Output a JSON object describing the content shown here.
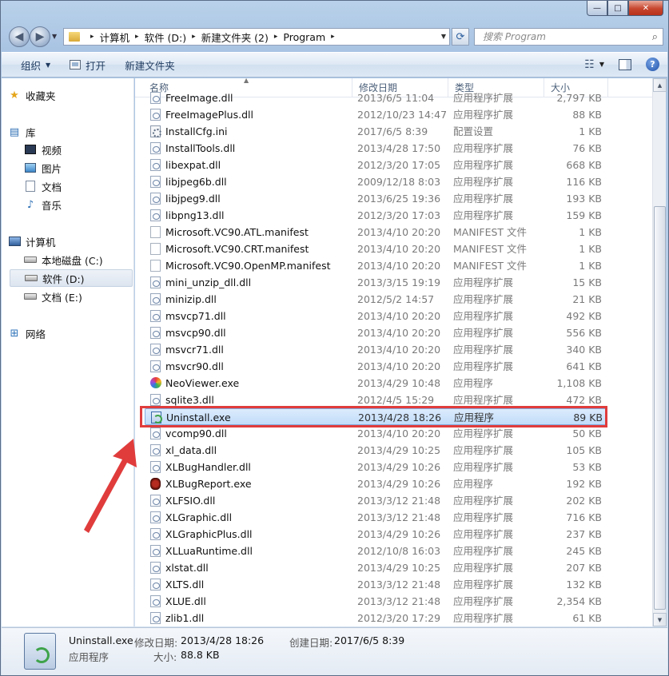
{
  "window": {
    "controls": {
      "minimize": "—",
      "maximize": "□",
      "close": "✕"
    }
  },
  "address": {
    "breadcrumbs": [
      "计算机",
      "软件 (D:)",
      "新建文件夹 (2)",
      "Program"
    ],
    "search_placeholder": "搜索 Program"
  },
  "toolbar": {
    "organize_label": "组织",
    "open_label": "打开",
    "new_folder_label": "新建文件夹"
  },
  "sidebar": {
    "favorites": "收藏夹",
    "libraries": "库",
    "library_items": [
      "视频",
      "图片",
      "文档",
      "音乐"
    ],
    "computer": "计算机",
    "drives": [
      "本地磁盘 (C:)",
      "软件 (D:)",
      "文档 (E:)"
    ],
    "network": "网络"
  },
  "columns": {
    "name": "名称",
    "date": "修改日期",
    "type": "类型",
    "size": "大小"
  },
  "files": [
    {
      "name": "FreeImage.dll",
      "date": "2013/6/5 11:04",
      "type": "应用程序扩展",
      "size": "2,797 KB",
      "icon": "dll-icon"
    },
    {
      "name": "FreeImagePlus.dll",
      "date": "2012/10/23 14:47",
      "type": "应用程序扩展",
      "size": "88 KB",
      "icon": "dll-icon"
    },
    {
      "name": "InstallCfg.ini",
      "date": "2017/6/5 8:39",
      "type": "配置设置",
      "size": "1 KB",
      "icon": "ini-icon"
    },
    {
      "name": "InstallTools.dll",
      "date": "2013/4/28 17:50",
      "type": "应用程序扩展",
      "size": "76 KB",
      "icon": "dll-icon"
    },
    {
      "name": "libexpat.dll",
      "date": "2012/3/20 17:05",
      "type": "应用程序扩展",
      "size": "668 KB",
      "icon": "dll-icon"
    },
    {
      "name": "libjpeg6b.dll",
      "date": "2009/12/18 8:03",
      "type": "应用程序扩展",
      "size": "116 KB",
      "icon": "dll-icon"
    },
    {
      "name": "libjpeg9.dll",
      "date": "2013/6/25 19:36",
      "type": "应用程序扩展",
      "size": "193 KB",
      "icon": "dll-icon"
    },
    {
      "name": "libpng13.dll",
      "date": "2012/3/20 17:03",
      "type": "应用程序扩展",
      "size": "159 KB",
      "icon": "dll-icon"
    },
    {
      "name": "Microsoft.VC90.ATL.manifest",
      "date": "2013/4/10 20:20",
      "type": "MANIFEST 文件",
      "size": "1 KB",
      "icon": "manifest-icon"
    },
    {
      "name": "Microsoft.VC90.CRT.manifest",
      "date": "2013/4/10 20:20",
      "type": "MANIFEST 文件",
      "size": "1 KB",
      "icon": "manifest-icon"
    },
    {
      "name": "Microsoft.VC90.OpenMP.manifest",
      "date": "2013/4/10 20:20",
      "type": "MANIFEST 文件",
      "size": "1 KB",
      "icon": "manifest-icon"
    },
    {
      "name": "mini_unzip_dll.dll",
      "date": "2013/3/15 19:19",
      "type": "应用程序扩展",
      "size": "15 KB",
      "icon": "dll-icon"
    },
    {
      "name": "minizip.dll",
      "date": "2012/5/2 14:57",
      "type": "应用程序扩展",
      "size": "21 KB",
      "icon": "dll-icon"
    },
    {
      "name": "msvcp71.dll",
      "date": "2013/4/10 20:20",
      "type": "应用程序扩展",
      "size": "492 KB",
      "icon": "dll-icon"
    },
    {
      "name": "msvcp90.dll",
      "date": "2013/4/10 20:20",
      "type": "应用程序扩展",
      "size": "556 KB",
      "icon": "dll-icon"
    },
    {
      "name": "msvcr71.dll",
      "date": "2013/4/10 20:20",
      "type": "应用程序扩展",
      "size": "340 KB",
      "icon": "dll-icon"
    },
    {
      "name": "msvcr90.dll",
      "date": "2013/4/10 20:20",
      "type": "应用程序扩展",
      "size": "641 KB",
      "icon": "dll-icon"
    },
    {
      "name": "NeoViewer.exe",
      "date": "2013/4/29 10:48",
      "type": "应用程序",
      "size": "1,108 KB",
      "icon": "neoviewer-icon"
    },
    {
      "name": "sqlite3.dll",
      "date": "2012/4/5 15:29",
      "type": "应用程序扩展",
      "size": "472 KB",
      "icon": "dll-icon"
    },
    {
      "name": "Uninstall.exe",
      "date": "2013/4/28 18:26",
      "type": "应用程序",
      "size": "89 KB",
      "icon": "uninstall-icon"
    },
    {
      "name": "vcomp90.dll",
      "date": "2013/4/10 20:20",
      "type": "应用程序扩展",
      "size": "50 KB",
      "icon": "dll-icon"
    },
    {
      "name": "xl_data.dll",
      "date": "2013/4/29 10:25",
      "type": "应用程序扩展",
      "size": "105 KB",
      "icon": "dll-icon"
    },
    {
      "name": "XLBugHandler.dll",
      "date": "2013/4/29 10:26",
      "type": "应用程序扩展",
      "size": "53 KB",
      "icon": "dll-icon"
    },
    {
      "name": "XLBugReport.exe",
      "date": "2013/4/29 10:26",
      "type": "应用程序",
      "size": "192 KB",
      "icon": "bug-icon"
    },
    {
      "name": "XLFSIO.dll",
      "date": "2013/3/12 21:48",
      "type": "应用程序扩展",
      "size": "202 KB",
      "icon": "dll-icon"
    },
    {
      "name": "XLGraphic.dll",
      "date": "2013/3/12 21:48",
      "type": "应用程序扩展",
      "size": "716 KB",
      "icon": "dll-icon"
    },
    {
      "name": "XLGraphicPlus.dll",
      "date": "2013/4/29 10:26",
      "type": "应用程序扩展",
      "size": "237 KB",
      "icon": "dll-icon"
    },
    {
      "name": "XLLuaRuntime.dll",
      "date": "2012/10/8 16:03",
      "type": "应用程序扩展",
      "size": "245 KB",
      "icon": "dll-icon"
    },
    {
      "name": "xlstat.dll",
      "date": "2013/4/29 10:25",
      "type": "应用程序扩展",
      "size": "207 KB",
      "icon": "dll-icon"
    },
    {
      "name": "XLTS.dll",
      "date": "2013/3/12 21:48",
      "type": "应用程序扩展",
      "size": "132 KB",
      "icon": "dll-icon"
    },
    {
      "name": "XLUE.dll",
      "date": "2013/3/12 21:48",
      "type": "应用程序扩展",
      "size": "2,354 KB",
      "icon": "dll-icon"
    },
    {
      "name": "zlib1.dll",
      "date": "2012/3/20 17:29",
      "type": "应用程序扩展",
      "size": "61 KB",
      "icon": "dll-icon"
    }
  ],
  "selected_index": 19,
  "details": {
    "name": "Uninstall.exe",
    "type": "应用程序",
    "modified_label": "修改日期:",
    "modified_value": "2013/4/28 18:26",
    "created_label": "创建日期:",
    "created_value": "2017/6/5 8:39",
    "size_label": "大小:",
    "size_value": "88.8 KB"
  },
  "colors": {
    "highlight_box": "#e03c3c",
    "selection": "#c1dcfa"
  }
}
